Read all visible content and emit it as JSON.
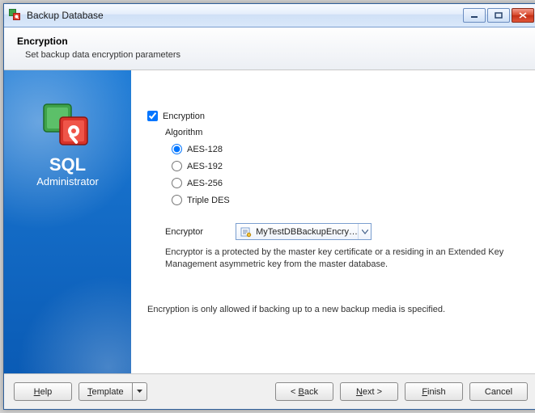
{
  "window": {
    "title": "Backup Database"
  },
  "header": {
    "title": "Encryption",
    "subtitle": "Set backup data encryption parameters"
  },
  "brand": {
    "title": "SQL",
    "subtitle": "Administrator"
  },
  "form": {
    "encryption_checkbox_label": "Encryption",
    "encryption_checked": true,
    "algorithm_group_label": "Algorithm",
    "algorithms": [
      {
        "label": "AES-128",
        "checked": true
      },
      {
        "label": "AES-192",
        "checked": false
      },
      {
        "label": "AES-256",
        "checked": false
      },
      {
        "label": "Triple DES",
        "checked": false
      }
    ],
    "encryptor_label": "Encryptor",
    "encryptor_value": "MyTestDBBackupEncryp...",
    "encryptor_help": "Encryptor is a protected by the master key certificate or a residing in an Extended Key Management asymmetric key from the master database.",
    "note": "Encryption is only allowed if backing up to a new backup media is specified."
  },
  "footer": {
    "help": "Help",
    "template": "Template",
    "back": "< Back",
    "next": "Next >",
    "finish": "Finish",
    "cancel": "Cancel"
  }
}
